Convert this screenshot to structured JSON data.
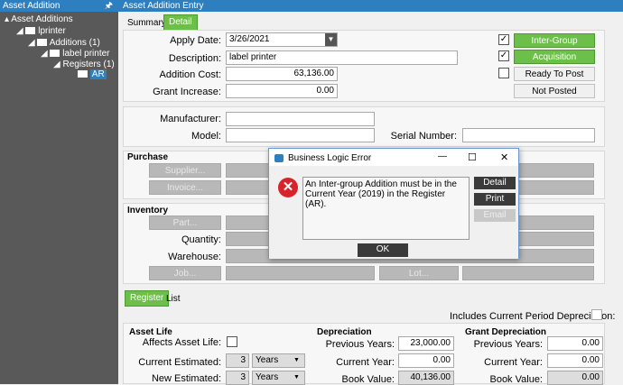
{
  "left_panel": {
    "title": "Asset Addition",
    "pin": "2",
    "tree": [
      "Asset Additions",
      "lprinter",
      "Additions (1)",
      "label printer",
      "Registers (1)",
      "AR"
    ]
  },
  "header": {
    "title": "Asset Addition Entry"
  },
  "tabs": {
    "summary": "Summary",
    "detail": "Detail"
  },
  "form": {
    "apply_date_label": "Apply Date:",
    "apply_date": "3/26/2021",
    "description_label": "Description:",
    "description": "label printer",
    "addition_cost_label": "Addition Cost:",
    "addition_cost": "63,136.00",
    "grant_increase_label": "Grant Increase:",
    "grant_increase": "0.00",
    "manufacturer_label": "Manufacturer:",
    "model_label": "Model:",
    "serial_label": "Serial Number:"
  },
  "side_buttons": {
    "intergroup": "Inter-Group",
    "acquisition": "Acquisition",
    "ready": "Ready To Post",
    "posted": "Not Posted"
  },
  "purchase": {
    "title": "Purchase",
    "supplier": "Supplier...",
    "invoice": "Invoice..."
  },
  "inventory": {
    "title": "Inventory",
    "part": "Part...",
    "quantity": "Quantity:",
    "warehouse": "Warehouse:",
    "job": "Job...",
    "lot": "Lot..."
  },
  "bottom_tabs": {
    "register": "Register",
    "list": "List"
  },
  "include_dep": "Includes Current Period Depreciation:",
  "asset_life": {
    "title": "Asset Life",
    "affects": "Affects Asset Life:",
    "current": "Current Estimated:",
    "current_val": "3",
    "current_unit": "Years",
    "new": "New Estimated:",
    "new_val": "3",
    "new_unit": "Years"
  },
  "depreciation": {
    "title": "Depreciation",
    "prev": "Previous Years:",
    "prev_val": "23,000.00",
    "cur": "Current Year:",
    "cur_val": "0.00",
    "book": "Book Value:",
    "book_val": "40,136.00"
  },
  "grant_dep": {
    "title": "Grant Depreciation",
    "prev": "Previous Years:",
    "prev_val": "0.00",
    "cur": "Current Year:",
    "cur_val": "0.00",
    "book": "Book Value:",
    "book_val": "0.00"
  },
  "dialog": {
    "title": "Business Logic Error",
    "message": "An Inter-group Addition must be in the Current Year (2019) in the Register (AR).",
    "detail": "Detail",
    "print": "Print",
    "email": "Email",
    "ok": "OK",
    "minimize": "—",
    "maximize": "☐",
    "close": "✕"
  }
}
